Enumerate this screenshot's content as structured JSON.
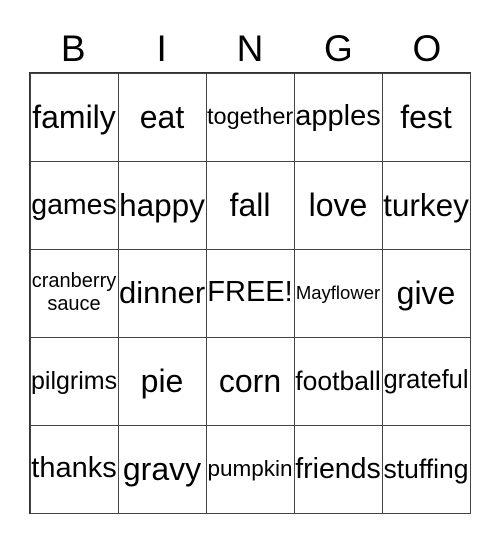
{
  "header": [
    "B",
    "I",
    "N",
    "G",
    "O"
  ],
  "cells": [
    [
      "family",
      "eat",
      "together",
      "apples",
      "fest"
    ],
    [
      "games",
      "happy",
      "fall",
      "love",
      "turkey"
    ],
    [
      "cranberry sauce",
      "dinner",
      "FREE!",
      "Mayflower",
      "give"
    ],
    [
      "pilgrims",
      "pie",
      "corn",
      "football",
      "grateful"
    ],
    [
      "thanks",
      "gravy",
      "pumpkin",
      "friends",
      "stuffing"
    ]
  ]
}
